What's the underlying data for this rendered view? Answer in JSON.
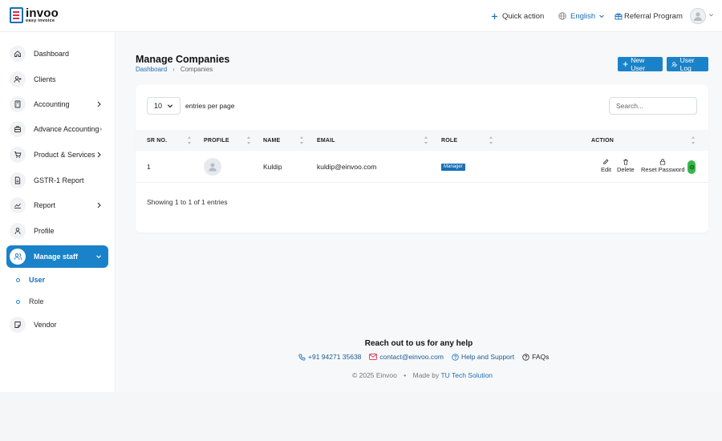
{
  "brand": {
    "name": "invoo",
    "tagline": "easy invoice"
  },
  "topbar": {
    "quick_action": "Quick action",
    "language": "English",
    "referral": "Referral Program"
  },
  "sidebar": {
    "items": [
      {
        "label": "Dashboard"
      },
      {
        "label": "Clients"
      },
      {
        "label": "Accounting"
      },
      {
        "label": "Advance Accounting"
      },
      {
        "label": "Product & Services"
      },
      {
        "label": "GSTR-1 Report"
      },
      {
        "label": "Report"
      },
      {
        "label": "Profile"
      },
      {
        "label": "Manage staff"
      },
      {
        "label": "Vendor"
      }
    ],
    "sub_items": [
      {
        "label": "User"
      },
      {
        "label": "Role"
      }
    ]
  },
  "page": {
    "title": "Manage Companies",
    "breadcrumb": {
      "home": "Dashboard",
      "current": "Companies"
    },
    "new_user": "New User",
    "user_log": "User Log"
  },
  "table": {
    "page_size": "10",
    "entries_label": "entries per page",
    "search_placeholder": "Search...",
    "columns": [
      "SR NO.",
      "PROFILE",
      "NAME",
      "EMAIL",
      "ROLE",
      "ACTION"
    ],
    "rows": [
      {
        "sr": "1",
        "name": "Kuldip",
        "email": "kuldip@einvoo.com",
        "role": "Manager"
      }
    ],
    "actions": {
      "edit": "Edit",
      "delete": "Delete",
      "reset": "Reset Password"
    },
    "showing": "Showing 1 to 1 of 1 entries"
  },
  "footer": {
    "title": "Reach out to us for any help",
    "phone": "+91 94271 35638",
    "email": "contact@einvoo.com",
    "help": "Help and Support",
    "faqs": "FAQs",
    "copyright": "© 2025 Einvoo",
    "made_by": "Made by",
    "company": "TU Tech Solution"
  },
  "colors": {
    "primary": "#1a82c8",
    "brand_red": "#e02a4a",
    "toggle_on": "#39b54a"
  }
}
